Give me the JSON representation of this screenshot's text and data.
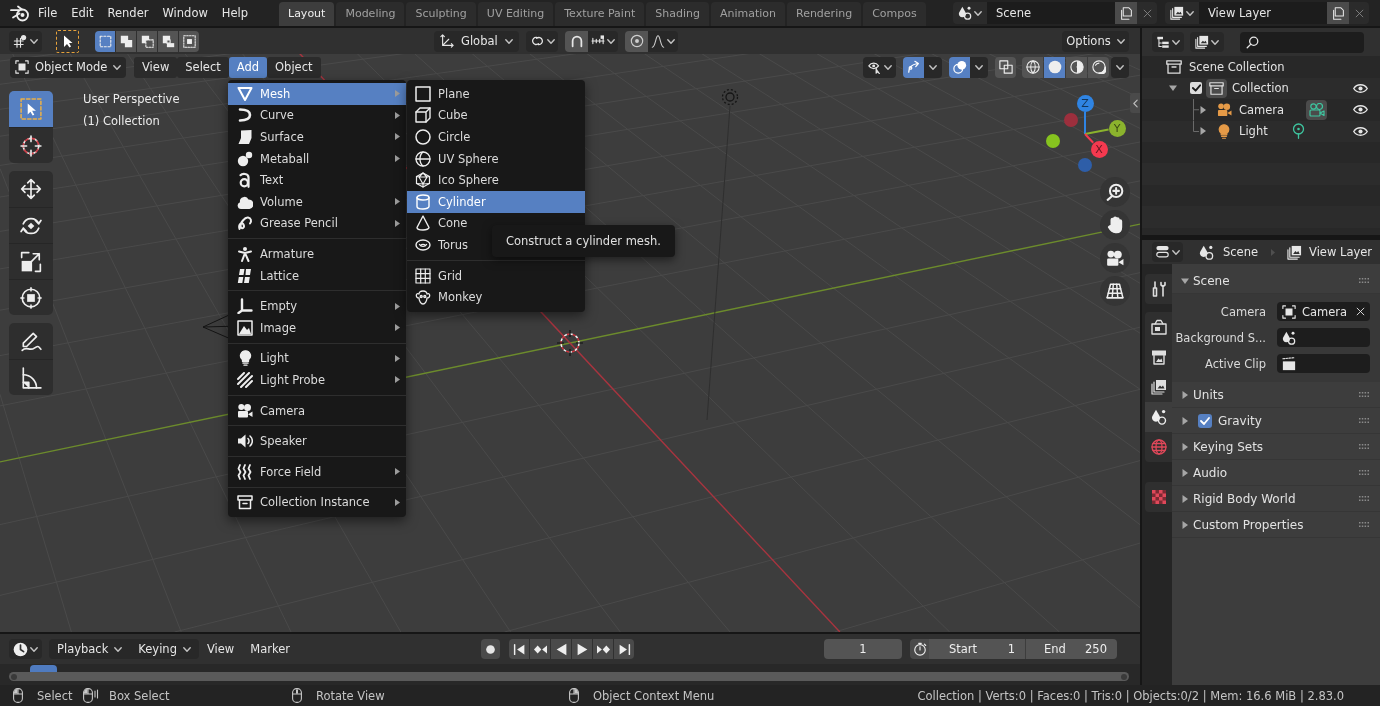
{
  "topbar": {
    "menus": [
      "File",
      "Edit",
      "Render",
      "Window",
      "Help"
    ],
    "workspaces": [
      {
        "label": "Layout",
        "selected": true
      },
      {
        "label": "Modeling",
        "selected": false
      },
      {
        "label": "Sculpting",
        "selected": false
      },
      {
        "label": "UV Editing",
        "selected": false
      },
      {
        "label": "Texture Paint",
        "selected": false
      },
      {
        "label": "Shading",
        "selected": false
      },
      {
        "label": "Animation",
        "selected": false
      },
      {
        "label": "Rendering",
        "selected": false
      },
      {
        "label": "Compos",
        "selected": false
      }
    ],
    "scene": "Scene",
    "view_layer": "View Layer"
  },
  "tool_header": {
    "select_modes": [
      {
        "selected": true
      },
      {
        "selected": false
      },
      {
        "selected": false
      },
      {
        "selected": false
      },
      {
        "selected": false
      }
    ],
    "orientation": "Global",
    "snap_on": false,
    "proportional_on": false,
    "options": "Options"
  },
  "viewport_header": {
    "mode": "Object Mode",
    "menus": [
      {
        "label": "View",
        "selected": false
      },
      {
        "label": "Select",
        "selected": false
      },
      {
        "label": "Add",
        "selected": true
      },
      {
        "label": "Object",
        "selected": false
      }
    ],
    "toggles": [
      {
        "kind": "gizmo",
        "on": true
      },
      {
        "kind": "overlay",
        "on": true
      },
      {
        "kind": "xray",
        "on": false
      }
    ],
    "shading": [
      {
        "selected": false
      },
      {
        "selected": true
      },
      {
        "selected": false
      },
      {
        "selected": false
      }
    ]
  },
  "viewport": {
    "tool_groups": [
      {
        "tools": [
          {
            "selected": true
          },
          {
            "selected": false
          }
        ]
      },
      {
        "tools": [
          {
            "selected": false
          },
          {
            "selected": false
          },
          {
            "selected": false
          },
          {
            "selected": false
          }
        ]
      },
      {
        "tools": [
          {
            "selected": false
          },
          {
            "selected": false
          }
        ]
      }
    ],
    "view_name": "User Perspective",
    "collection": "(1) Collection",
    "gizmo_axes": [
      {
        "label": "Z",
        "color": "#2f84e3"
      },
      {
        "label": "Y",
        "color": "#8bb32d"
      },
      {
        "label": "X",
        "color": "#f5394f"
      }
    ]
  },
  "add_menu": {
    "groups": [
      {
        "items": [
          {
            "label": "Mesh",
            "submenu": true,
            "selected": true
          },
          {
            "label": "Curve",
            "submenu": true,
            "selected": false
          },
          {
            "label": "Surface",
            "submenu": true,
            "selected": false
          },
          {
            "label": "Metaball",
            "submenu": true,
            "selected": false
          },
          {
            "label": "Text",
            "submenu": false,
            "selected": false
          },
          {
            "label": "Volume",
            "submenu": true,
            "selected": false
          },
          {
            "label": "Grease Pencil",
            "submenu": true,
            "selected": false
          }
        ]
      },
      {
        "items": [
          {
            "label": "Armature",
            "submenu": false,
            "selected": false
          },
          {
            "label": "Lattice",
            "submenu": false,
            "selected": false
          }
        ]
      },
      {
        "items": [
          {
            "label": "Empty",
            "submenu": true,
            "selected": false
          },
          {
            "label": "Image",
            "submenu": true,
            "selected": false
          }
        ]
      },
      {
        "items": [
          {
            "label": "Light",
            "submenu": true,
            "selected": false
          },
          {
            "label": "Light Probe",
            "submenu": true,
            "selected": false
          }
        ]
      },
      {
        "items": [
          {
            "label": "Camera",
            "submenu": false,
            "selected": false
          }
        ]
      },
      {
        "items": [
          {
            "label": "Speaker",
            "submenu": false,
            "selected": false
          }
        ]
      },
      {
        "items": [
          {
            "label": "Force Field",
            "submenu": true,
            "selected": false
          }
        ]
      },
      {
        "items": [
          {
            "label": "Collection Instance",
            "submenu": true,
            "selected": false
          }
        ]
      }
    ]
  },
  "mesh_menu": {
    "groups": [
      {
        "items": [
          {
            "label": "Plane",
            "selected": false
          },
          {
            "label": "Cube",
            "selected": false
          },
          {
            "label": "Circle",
            "selected": false
          },
          {
            "label": "UV Sphere",
            "selected": false
          },
          {
            "label": "Ico Sphere",
            "selected": false
          },
          {
            "label": "Cylinder",
            "selected": true
          },
          {
            "label": "Cone",
            "selected": false
          },
          {
            "label": "Torus",
            "selected": false
          }
        ]
      },
      {
        "items": [
          {
            "label": "Grid",
            "selected": false
          },
          {
            "label": "Monkey",
            "selected": false
          }
        ]
      }
    ]
  },
  "tooltip": "Construct a cylinder mesh.",
  "timeline": {
    "menus": [
      {
        "label": "Playback",
        "dropdown": true
      },
      {
        "label": "Keying",
        "dropdown": true
      },
      {
        "label": "View",
        "dropdown": false
      },
      {
        "label": "Marker",
        "dropdown": false
      }
    ],
    "current_frame": "1",
    "start_label": "Start",
    "start": "1",
    "end_label": "End",
    "end": "250"
  },
  "outliner": {
    "root": "Scene Collection",
    "items": [
      {
        "label": "Collection",
        "kind": "collection",
        "checked": true,
        "expanded": true,
        "active": true,
        "visible": true,
        "children": [
          {
            "label": "Camera",
            "kind": "camera",
            "expanded": false,
            "data_active": true,
            "visible": true
          },
          {
            "label": "Light",
            "kind": "light",
            "expanded": false,
            "data_active": false,
            "visible": true
          }
        ]
      }
    ]
  },
  "properties": {
    "breadcrumb": [
      "Scene",
      "View Layer"
    ],
    "tab_groups": [
      {
        "tabs": [
          {
            "selected": false
          }
        ]
      },
      {
        "tabs": [
          {
            "selected": false
          },
          {
            "selected": false
          },
          {
            "selected": false
          },
          {
            "selected": true
          },
          {
            "selected": false
          }
        ]
      },
      {
        "tabs": [
          {
            "selected": false
          }
        ]
      }
    ],
    "panels": [
      {
        "label": "Scene",
        "kind": "plain",
        "expanded": true,
        "fields": [
          {
            "label": "Camera",
            "value": "Camera"
          },
          {
            "label": "Background S..."
          },
          {
            "label": "Active Clip"
          }
        ]
      },
      {
        "label": "Units",
        "kind": "plain",
        "expanded": false
      },
      {
        "label": "Gravity",
        "kind": "checkbox",
        "checked": true,
        "expanded": false
      },
      {
        "label": "Keying Sets",
        "kind": "plain",
        "expanded": false
      },
      {
        "label": "Audio",
        "kind": "plain",
        "expanded": false
      },
      {
        "label": "Rigid Body World",
        "kind": "plain",
        "expanded": false
      },
      {
        "label": "Custom Properties",
        "kind": "plain",
        "expanded": false
      }
    ]
  },
  "status_bar": {
    "hints": [
      "Select",
      "Box Select",
      "Rotate View",
      "Object Context Menu"
    ],
    "stats": "Collection | Verts:0 | Faces:0 | Tris:0 | Objects:0/2 | Mem: 16.6 MiB | 2.83.0"
  }
}
